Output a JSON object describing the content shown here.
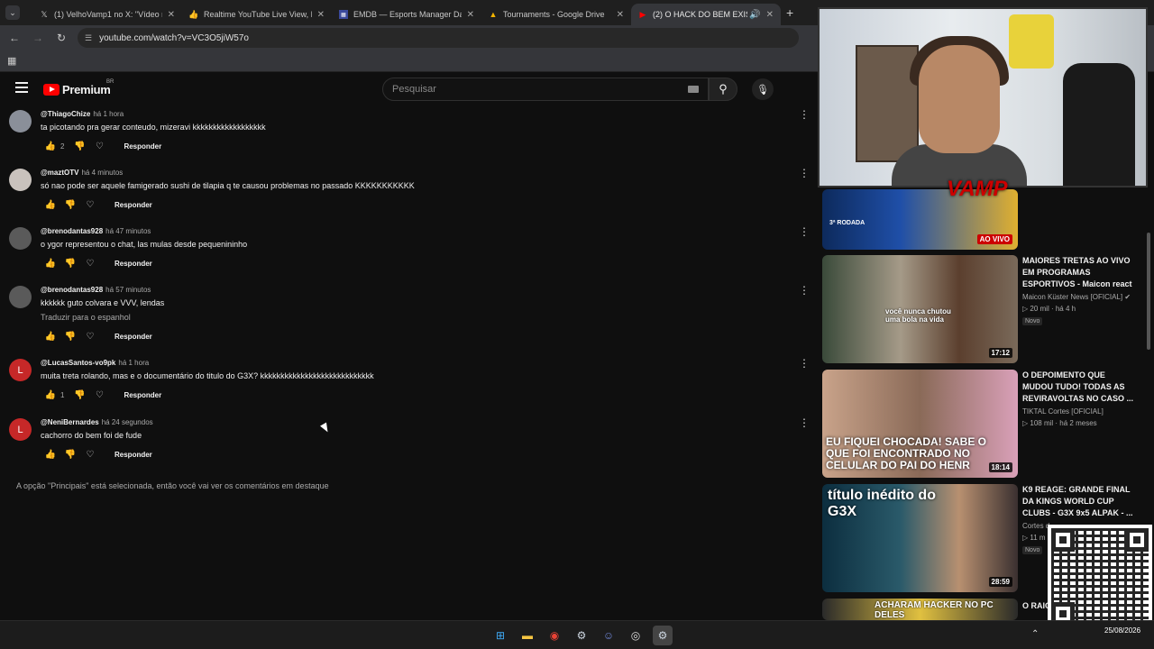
{
  "browser": {
    "tabs": [
      {
        "label": "(1) VelhoVamp1 no X: \"Vídeo n",
        "icon": "x-logo-icon",
        "active": false
      },
      {
        "label": "Realtime YouTube Live View, Li",
        "icon": "thumbs-up-icon",
        "active": false
      },
      {
        "label": "EMDB — Esports Manager Dat",
        "icon": "emdb-icon",
        "active": false
      },
      {
        "label": "Tournaments - Google Drive",
        "icon": "google-drive-icon",
        "active": false
      },
      {
        "label": "(2) O HACK DO BEM EXIST",
        "icon": "youtube-icon",
        "active": true
      }
    ],
    "url": "youtube.com/watch?v=VC3O5jiW57o"
  },
  "youtube": {
    "logo_text": "Premium",
    "country": "BR",
    "search_placeholder": "Pesquisar"
  },
  "comments": [
    {
      "author": "@ThiagoChize",
      "when": "há 1 hora",
      "text": "ta picotando pra gerar conteudo, mizeravi kkkkkkkkkkkkkkkkkk",
      "likes": "2",
      "avatar_letter": "",
      "avatar_color": "#8a8f99",
      "translate": ""
    },
    {
      "author": "@maztOTV",
      "when": "há 4 minutos",
      "text": "só nao pode ser aquele famigerado sushi de tilapia q te causou problemas no passado KKKKKKKKKKK",
      "likes": "",
      "avatar_letter": "",
      "avatar_color": "#c9c2bd",
      "translate": ""
    },
    {
      "author": "@brenodantas928",
      "when": "há 47 minutos",
      "text": "o ygor representou o chat, las mulas desde pequenininho",
      "likes": "",
      "avatar_letter": "",
      "avatar_color": "#5a5a5a",
      "translate": ""
    },
    {
      "author": "@brenodantas928",
      "when": "há 57 minutos",
      "text": "kkkkkk guto colvara e VVV, lendas",
      "likes": "",
      "avatar_letter": "",
      "avatar_color": "#5a5a5a",
      "translate": "Traduzir para o espanhol"
    },
    {
      "author": "@LucasSantos-vo9pk",
      "when": "há 1 hora",
      "text": "muita treta rolando, mas e o documentário do titulo do G3X? kkkkkkkkkkkkkkkkkkkkkkkkkkkk",
      "likes": "1",
      "avatar_letter": "L",
      "avatar_color": "#c62828",
      "translate": ""
    },
    {
      "author": "@NeniBernardes",
      "when": "há 24 segundos",
      "text": "cachorro do bem foi de fude",
      "likes": "",
      "avatar_letter": "L",
      "avatar_color": "#c62828",
      "translate": ""
    }
  ],
  "reply_label": "Responder",
  "footnote": "A opção \"Principais\" está selecionada, então você vai ver os comentários em destaque",
  "stream_overlay": {
    "logo_text": "VAMP"
  },
  "related_videos": [
    {
      "title": "",
      "channel": "",
      "views": "",
      "age": "",
      "badge": "",
      "duration": "",
      "live_label": "AO VIVO",
      "thumb_text": "3ª RODADA"
    },
    {
      "title": "MAIORES TRETAS AO VIVO EM PROGRAMAS ESPORTIVOS - Maicon react",
      "channel": "Maicon Küster News [OFICIAL]",
      "views": "20 mil",
      "age": "há 4 h",
      "badge": "Novo",
      "duration": "17:12",
      "live_label": "",
      "thumb_text": "você nunca chutou uma bola na vida"
    },
    {
      "title": "O DEPOIMENTO QUE MUDOU TUDO! TODAS AS REVIRAVOLTAS NO CASO ...",
      "channel": "TIKTAL Cortes [OFICIAL]",
      "views": "108 mil",
      "age": "há 2 meses",
      "badge": "",
      "duration": "18:14",
      "live_label": "",
      "thumb_text": "EU FIQUEI CHOCADA! SABE O QUE FOI ENCONTRADO NO CELULAR DO PAI DO HENR"
    },
    {
      "title": "K9 REAGE: GRANDE FINAL DA KINGS WORLD CUP CLUBS - G3X 9x5 ALPAK - ...",
      "channel": "Cortes d",
      "views": "11 m",
      "age": "",
      "badge": "Novo",
      "duration": "28:59",
      "live_label": "",
      "thumb_text": "título inédito do G3X"
    },
    {
      "title": "O RAIO COM C",
      "channel": "",
      "views": "",
      "age": "",
      "badge": "",
      "duration": "",
      "live_label": "",
      "thumb_text": "ACHARAM HACKER NO PC DELES"
    }
  ],
  "taskbar": {
    "date": "25/08/2026",
    "icons": [
      "windows-start-icon",
      "file-explorer-icon",
      "chrome-icon",
      "steam-icon",
      "discord-icon",
      "obs-icon",
      "steam-app-icon"
    ]
  }
}
